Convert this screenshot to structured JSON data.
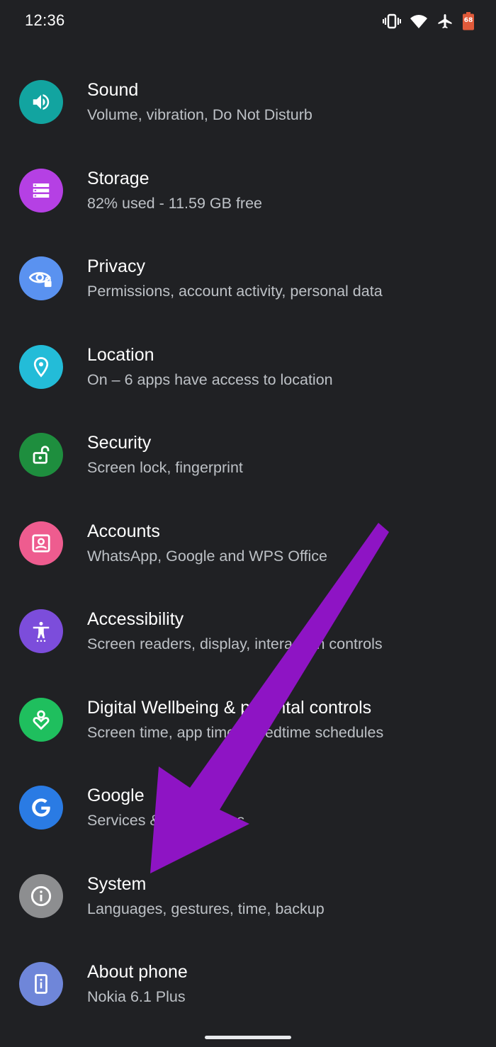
{
  "status_bar": {
    "time": "12:36",
    "battery_level": "68",
    "icons": [
      "vibrate-icon",
      "wifi-icon",
      "airplane-icon",
      "battery-icon"
    ]
  },
  "colors": {
    "background": "#202124",
    "title_text": "#ffffff",
    "subtitle_text": "#bdc1c6",
    "arrow": "#8e14c4"
  },
  "settings": {
    "items": [
      {
        "title": "Sound",
        "subtitle": "Volume, vibration, Do Not Disturb",
        "icon": "volume-icon",
        "color": "#12a4a0"
      },
      {
        "title": "Storage",
        "subtitle": "82% used - 11.59 GB free",
        "icon": "storage-icon",
        "color": "#b540e4"
      },
      {
        "title": "Privacy",
        "subtitle": "Permissions, account activity, personal data",
        "icon": "privacy-eye-icon",
        "color": "#5a92f0"
      },
      {
        "title": "Location",
        "subtitle": "On – 6 apps have access to location",
        "icon": "location-pin-icon",
        "color": "#23bcd8"
      },
      {
        "title": "Security",
        "subtitle": "Screen lock, fingerprint",
        "icon": "unlocked-padlock-icon",
        "color": "#1e8e3e"
      },
      {
        "title": "Accounts",
        "subtitle": "WhatsApp, Google and WPS Office",
        "icon": "account-box-icon",
        "color": "#ee5c8f"
      },
      {
        "title": "Accessibility",
        "subtitle": "Screen readers, display, interaction controls",
        "icon": "accessibility-person-icon",
        "color": "#7c4ddb"
      },
      {
        "title": "Digital Wellbeing & parental controls",
        "subtitle": "Screen time, app timers, bedtime schedules",
        "icon": "wellbeing-heart-icon",
        "color": "#1fbf5e"
      },
      {
        "title": "Google",
        "subtitle": "Services & preferences",
        "icon": "google-g-icon",
        "color": "#2a7be4"
      },
      {
        "title": "System",
        "subtitle": "Languages, gestures, time, backup",
        "icon": "info-icon",
        "color": "#8d8e90"
      },
      {
        "title": "About phone",
        "subtitle": "Nokia 6.1 Plus",
        "icon": "phone-info-icon",
        "color": "#6f86d9"
      }
    ]
  }
}
